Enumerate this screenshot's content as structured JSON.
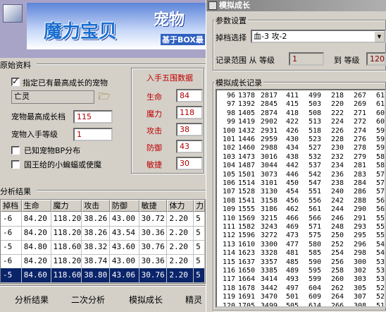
{
  "banner": {
    "logo_text": "魔力宝贝",
    "logo_text2": "宠物",
    "tagline": "基于BOX最"
  },
  "left": {
    "section_original": "原始资料",
    "chk_specify_label": "指定已有最高成长的宠物",
    "chk_specify_checked": true,
    "pet_name": "亡灵",
    "folder_icon": "folder-open-icon",
    "max_growth_label": "宠物最高成长档",
    "max_growth_value": "115",
    "acquire_level_label": "宠物入手等级",
    "acquire_level_value": "1",
    "chk_bp_label": "已知宠物BP分布",
    "chk_bp_checked": false,
    "chk_king_label": "国王给的小蝙蝠或使魔",
    "chk_king_checked": false,
    "stats_title": "入手五围数据",
    "stats": [
      {
        "label": "生命",
        "value": "84"
      },
      {
        "label": "魔力",
        "value": "118"
      },
      {
        "label": "攻击",
        "value": "38"
      },
      {
        "label": "防御",
        "value": "43"
      },
      {
        "label": "敏捷",
        "value": "30"
      }
    ],
    "section_analysis": "分析结果",
    "table_headers": [
      "掉档",
      "生命",
      "魔力",
      "攻击",
      "防御",
      "敏捷",
      "体力",
      "力"
    ],
    "table_rows": [
      [
        "-6",
        "84.20",
        "118.20",
        "38.26",
        "43.00",
        "30.72",
        "2.20",
        "5"
      ],
      [
        "-6",
        "84.20",
        "118.20",
        "38.26",
        "43.54",
        "30.36",
        "2.20",
        "5"
      ],
      [
        "-5",
        "84.80",
        "118.60",
        "38.32",
        "43.60",
        "30.76",
        "2.20",
        "5"
      ],
      [
        "-6",
        "84.20",
        "118.20",
        "38.74",
        "43.00",
        "30.36",
        "2.20",
        "5"
      ],
      [
        "-5",
        "84.60",
        "118.60",
        "38.80",
        "43.06",
        "30.76",
        "2.20",
        "5"
      ]
    ],
    "selected_row": 4,
    "buttons": [
      "分析结果",
      "二次分析",
      "模拟成长",
      "精灵"
    ]
  },
  "right": {
    "title": "模拟成长",
    "group_params": "参数设置",
    "drop_select_label": "掉档选择",
    "drop_select_value": "血-3 攻-2",
    "record_range_label": "记录范围 从 等级",
    "range_from": "1",
    "range_to_label": "到 等级",
    "range_to": "120",
    "group_records": "模拟成长记录",
    "records": [
      [
        "96",
        "1378",
        "2817",
        "411",
        "499",
        "218",
        "267",
        "61"
      ],
      [
        "97",
        "1392",
        "2845",
        "415",
        "503",
        "220",
        "269",
        "61"
      ],
      [
        "98",
        "1405",
        "2874",
        "418",
        "508",
        "222",
        "271",
        "60"
      ],
      [
        "99",
        "1419",
        "2902",
        "422",
        "513",
        "224",
        "272",
        "60"
      ],
      [
        "100",
        "1432",
        "2931",
        "426",
        "518",
        "226",
        "274",
        "59"
      ],
      [
        "101",
        "1446",
        "2959",
        "430",
        "523",
        "228",
        "276",
        "59"
      ],
      [
        "102",
        "1460",
        "2988",
        "434",
        "527",
        "230",
        "278",
        "59"
      ],
      [
        "103",
        "1473",
        "3016",
        "438",
        "532",
        "232",
        "279",
        "58"
      ],
      [
        "104",
        "1487",
        "3044",
        "442",
        "537",
        "234",
        "281",
        "58"
      ],
      [
        "105",
        "1501",
        "3073",
        "446",
        "542",
        "236",
        "283",
        "57"
      ],
      [
        "106",
        "1514",
        "3101",
        "450",
        "547",
        "238",
        "284",
        "57"
      ],
      [
        "107",
        "1528",
        "3130",
        "454",
        "551",
        "240",
        "286",
        "57"
      ],
      [
        "108",
        "1541",
        "3158",
        "456",
        "556",
        "242",
        "288",
        "56"
      ],
      [
        "109",
        "1555",
        "3186",
        "462",
        "561",
        "244",
        "290",
        "56"
      ],
      [
        "110",
        "1569",
        "3215",
        "466",
        "566",
        "246",
        "291",
        "55"
      ],
      [
        "111",
        "1582",
        "3243",
        "469",
        "571",
        "248",
        "293",
        "55"
      ],
      [
        "112",
        "1596",
        "3272",
        "473",
        "575",
        "250",
        "295",
        "55"
      ],
      [
        "113",
        "1610",
        "3300",
        "477",
        "580",
        "252",
        "296",
        "54"
      ],
      [
        "114",
        "1623",
        "3328",
        "481",
        "585",
        "254",
        "298",
        "54"
      ],
      [
        "115",
        "1637",
        "3357",
        "485",
        "590",
        "256",
        "300",
        "53"
      ],
      [
        "116",
        "1650",
        "3385",
        "489",
        "595",
        "258",
        "302",
        "53"
      ],
      [
        "117",
        "1664",
        "3414",
        "493",
        "599",
        "260",
        "303",
        "53"
      ],
      [
        "118",
        "1678",
        "3442",
        "497",
        "604",
        "262",
        "305",
        "52"
      ],
      [
        "119",
        "1691",
        "3470",
        "501",
        "609",
        "264",
        "307",
        "52"
      ],
      [
        "120",
        "1705",
        "3499",
        "505",
        "614",
        "266",
        "308",
        "51"
      ]
    ]
  }
}
